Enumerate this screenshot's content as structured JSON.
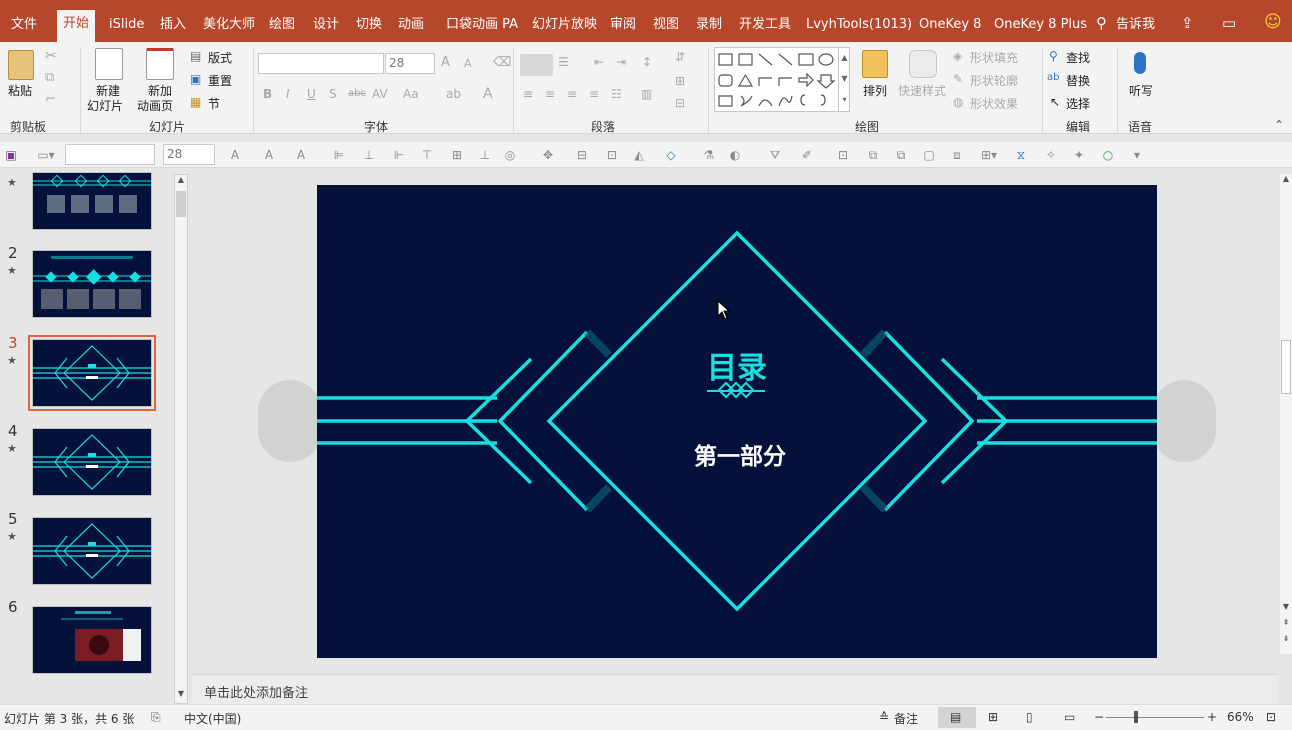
{
  "menu": {
    "file": "文件",
    "home": "开始",
    "islide": "iSlide",
    "insert": "插入",
    "meihua": "美化大师",
    "draw": "绘图",
    "design": "设计",
    "transitions": "切换",
    "animations": "动画",
    "pocket": "口袋动画 PA",
    "slideshow": "幻灯片放映",
    "review": "审阅",
    "view": "视图",
    "record": "录制",
    "developer": "开发工具",
    "lvyh": "LvyhTools(1013)",
    "onekey8": "OneKey 8",
    "onekey8plus": "OneKey 8 Plus",
    "tellme": "告诉我"
  },
  "ribbon": {
    "clipboard": {
      "paste": "粘贴",
      "label": "剪贴板"
    },
    "slides": {
      "new_slide_1": "新建",
      "new_slide_2": "幻灯片",
      "new_anim_1": "新加",
      "new_anim_2": "动画页",
      "layout": "版式",
      "reset": "重置",
      "section": "节",
      "label": "幻灯片"
    },
    "font": {
      "size": "28",
      "label": "字体"
    },
    "paragraph": {
      "label": "段落"
    },
    "drawing": {
      "arrange": "排列",
      "quick_styles": "快速样式",
      "fill": "形状填充",
      "outline": "形状轮廓",
      "effects": "形状效果",
      "label": "绘图"
    },
    "editing": {
      "find": "查找",
      "replace": "替换",
      "select": "选择",
      "label": "编辑"
    },
    "voice": {
      "dictate": "听写",
      "label": "语音"
    }
  },
  "qat": {
    "font_size": "28"
  },
  "thumbnails": [
    {
      "num": "",
      "star": "★"
    },
    {
      "num": "2",
      "star": "★"
    },
    {
      "num": "3",
      "star": "★"
    },
    {
      "num": "4",
      "star": "★"
    },
    {
      "num": "5",
      "star": "★"
    },
    {
      "num": "6",
      "star": ""
    }
  ],
  "slide": {
    "title": "目录",
    "subtitle": "第一部分"
  },
  "notes": {
    "placeholder": "单击此处添加备注"
  },
  "status": {
    "slide_info": "幻灯片 第 3 张，共 6 张",
    "language": "中文(中国)",
    "notes": "备注",
    "zoom": "66%"
  },
  "colors": {
    "accent": "#b7472a",
    "slide_bg": "#04113a",
    "cyan": "#16e0e0"
  }
}
